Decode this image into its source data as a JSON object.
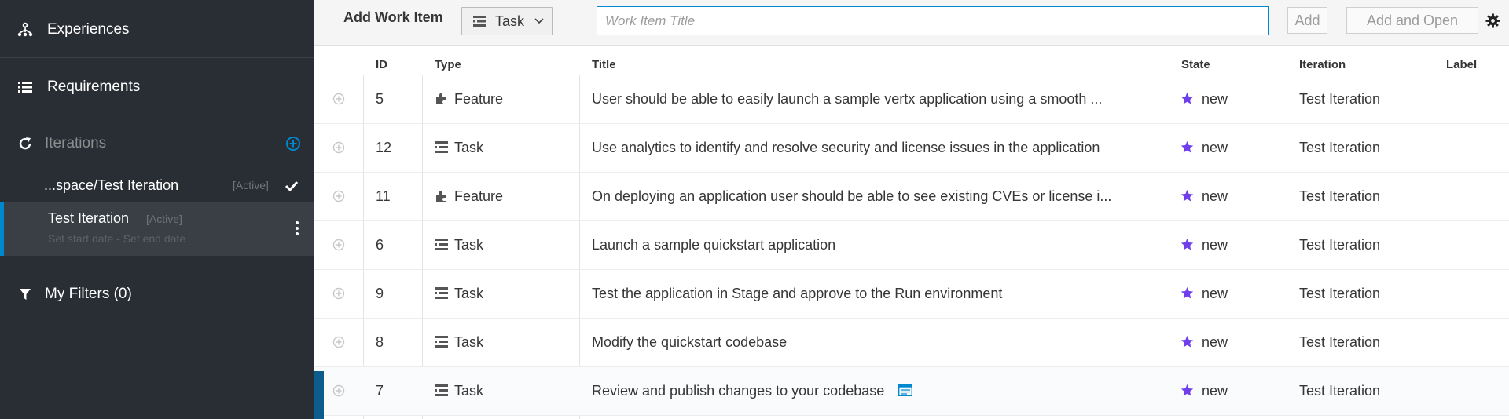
{
  "sidebar": {
    "experiences": "Experiences",
    "requirements": "Requirements",
    "iterations": "Iterations",
    "iteration_rows": [
      {
        "name": "...space/Test Iteration",
        "badge": "[Active]"
      },
      {
        "name": "Test Iteration",
        "badge": "[Active]",
        "dates": "Set start date - Set end date"
      }
    ],
    "my_filters": "My Filters (0)"
  },
  "toolbar": {
    "title": "Add Work Item",
    "type_value": "Task",
    "title_placeholder": "Work Item Title",
    "add_label": "Add",
    "add_open_label": "Add and Open"
  },
  "table": {
    "headers": {
      "id": "ID",
      "type": "Type",
      "title": "Title",
      "state": "State",
      "iteration": "Iteration",
      "label": "Label"
    },
    "rows": [
      {
        "id": "5",
        "type": "Feature",
        "type_icon": "puzzle-icon",
        "title": "User should be able to easily launch a sample vertx application using a smooth ...",
        "state": "new",
        "iteration": "Test Iteration"
      },
      {
        "id": "12",
        "type": "Task",
        "type_icon": "task-icon",
        "title": "Use analytics to identify and resolve security and license issues in the application",
        "state": "new",
        "iteration": "Test Iteration"
      },
      {
        "id": "11",
        "type": "Feature",
        "type_icon": "puzzle-icon",
        "title": "On deploying an application user should be able to see existing CVEs or license i...",
        "state": "new",
        "iteration": "Test Iteration"
      },
      {
        "id": "6",
        "type": "Task",
        "type_icon": "task-icon",
        "title": "Launch a sample quickstart application",
        "state": "new",
        "iteration": "Test Iteration"
      },
      {
        "id": "9",
        "type": "Task",
        "type_icon": "task-icon",
        "title": "Test the application in Stage and approve to the Run environment",
        "state": "new",
        "iteration": "Test Iteration"
      },
      {
        "id": "8",
        "type": "Task",
        "type_icon": "task-icon",
        "title": "Modify the quickstart codebase",
        "state": "new",
        "iteration": "Test Iteration"
      },
      {
        "id": "7",
        "type": "Task",
        "type_icon": "task-icon",
        "title": "Review and publish changes to your codebase",
        "state": "new",
        "iteration": "Test Iteration"
      }
    ]
  },
  "colors": {
    "sidebar_bg": "#292e34",
    "accent": "#0088ce",
    "state_star": "#703fec"
  }
}
